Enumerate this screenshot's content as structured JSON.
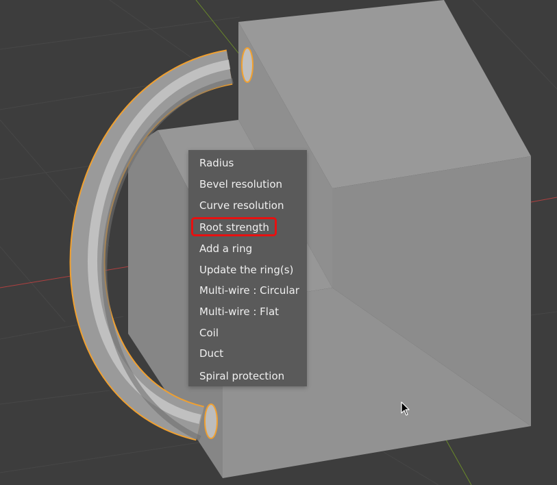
{
  "context_menu": {
    "items": [
      {
        "label": "Radius"
      },
      {
        "label": "Bevel resolution"
      },
      {
        "label": "Curve resolution"
      },
      {
        "label": "Root strength",
        "highlighted": true
      },
      {
        "label": "Add a ring"
      },
      {
        "label": "Update the ring(s)"
      },
      {
        "label": "Multi-wire : Circular"
      },
      {
        "label": "Multi-wire : Flat"
      },
      {
        "label": "Coil"
      },
      {
        "label": "Duct"
      },
      {
        "label": "Spiral protection"
      }
    ],
    "highlight_color": "#e81010"
  },
  "viewport": {
    "background_color": "#3d3d3d",
    "selection_outline_color": "#f0a030",
    "x_axis_color": "#b04040",
    "y_axis_color": "#6a8a2a",
    "cursor_icon": "mouse-pointer-icon"
  }
}
